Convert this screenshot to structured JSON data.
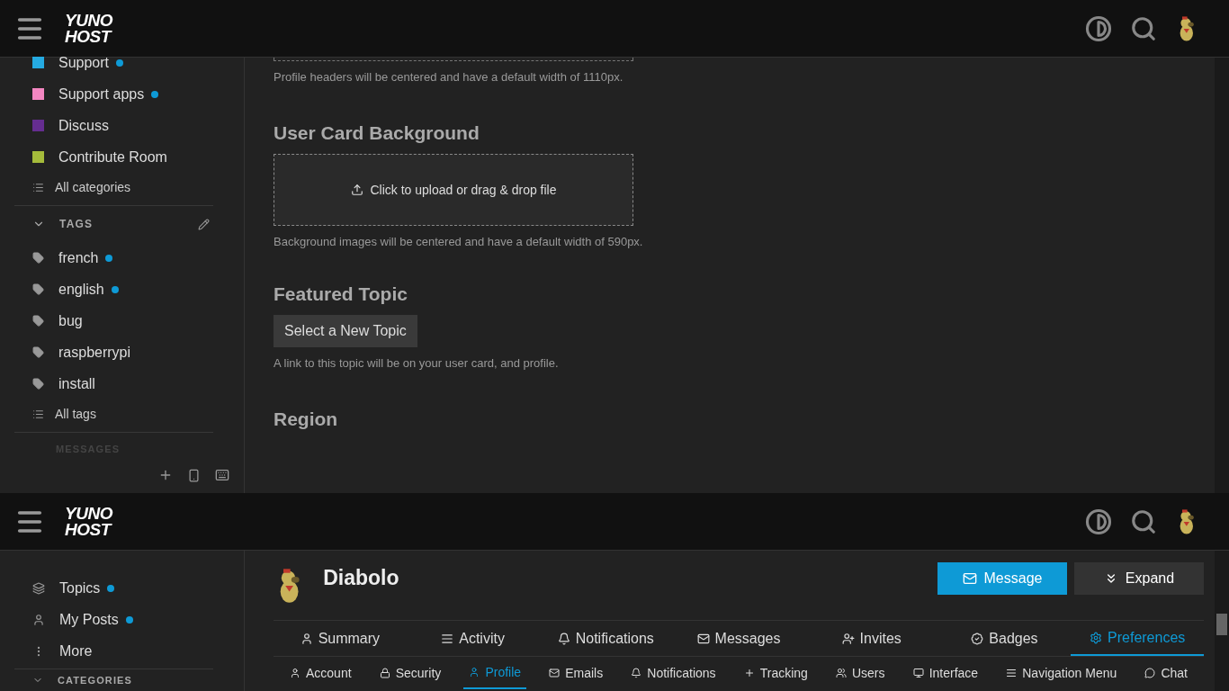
{
  "top_screen": {
    "header": {
      "logo_lines": [
        "YUNO",
        "HOST"
      ]
    },
    "sidebar": {
      "categories": [
        {
          "label": "Support",
          "color": "#25aae1",
          "unread": true
        },
        {
          "label": "Support apps",
          "color": "#f386c1",
          "unread": true
        },
        {
          "label": "Discuss",
          "color": "#652d90",
          "unread": false
        },
        {
          "label": "Contribute Room",
          "color": "#a5bb3b",
          "unread": false
        }
      ],
      "all_categories": "All categories",
      "tags_section": {
        "title": "TAGS",
        "expanded": true
      },
      "tags": [
        {
          "label": "french",
          "unread": true
        },
        {
          "label": "english",
          "unread": true
        },
        {
          "label": "bug",
          "unread": false
        },
        {
          "label": "raspberrypi",
          "unread": false
        },
        {
          "label": "install",
          "unread": false
        }
      ],
      "all_tags": "All tags",
      "messages_section": {
        "title": "MESSAGES"
      }
    },
    "content": {
      "profile_header_hint": "Profile headers will be centered and have a default width of 1110px.",
      "user_card": {
        "title": "User Card Background",
        "upload_label": "Click to upload or drag & drop file",
        "hint": "Background images will be centered and have a default width of 590px."
      },
      "featured_topic": {
        "title": "Featured Topic",
        "button": "Select a New Topic",
        "hint": "A link to this topic will be on your user card, and profile."
      },
      "region_title": "Region"
    }
  },
  "bottom_screen": {
    "header": {
      "logo_lines": [
        "YUNO",
        "HOST"
      ]
    },
    "sidebar": {
      "items": [
        {
          "kind": "topics",
          "label": "Topics",
          "unread": true
        },
        {
          "kind": "posts",
          "label": "My Posts",
          "unread": true
        },
        {
          "kind": "more",
          "label": "More",
          "unread": false
        }
      ],
      "categories_section": {
        "title": "CATEGORIES",
        "expanded": true
      }
    },
    "user": {
      "name": "Diabolo",
      "buttons": [
        {
          "kind": "message",
          "label": "Message"
        },
        {
          "kind": "expand",
          "label": "Expand"
        }
      ]
    },
    "nav_tabs": [
      {
        "label": "Summary",
        "selected": false
      },
      {
        "label": "Activity",
        "selected": false
      },
      {
        "label": "Notifications",
        "selected": false
      },
      {
        "label": "Messages",
        "selected": false
      },
      {
        "label": "Invites",
        "selected": false
      },
      {
        "label": "Badges",
        "selected": false
      },
      {
        "label": "Preferences",
        "selected": true
      }
    ],
    "sub_tabs": [
      {
        "label": "Account",
        "selected": false
      },
      {
        "label": "Security",
        "selected": false
      },
      {
        "label": "Profile",
        "selected": true
      },
      {
        "label": "Emails",
        "selected": false
      },
      {
        "label": "Notifications",
        "selected": false
      },
      {
        "label": "Tracking",
        "selected": false
      },
      {
        "label": "Users",
        "selected": false
      },
      {
        "label": "Interface",
        "selected": false
      },
      {
        "label": "Navigation Menu",
        "selected": false
      },
      {
        "label": "Chat",
        "selected": false
      }
    ]
  }
}
